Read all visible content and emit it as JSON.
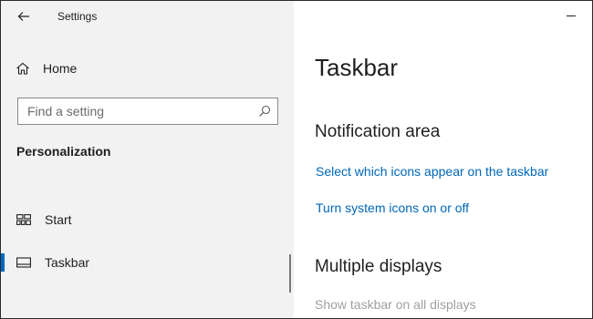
{
  "window": {
    "title": "Settings"
  },
  "sidebar": {
    "home_label": "Home",
    "search": {
      "placeholder": "Find a setting",
      "value": ""
    },
    "section_title": "Personalization",
    "items": [
      {
        "label": "Start",
        "icon": "start-icon",
        "selected": false
      },
      {
        "label": "Taskbar",
        "icon": "taskbar-icon",
        "selected": true
      }
    ]
  },
  "main": {
    "page_title": "Taskbar",
    "notification_area": {
      "heading": "Notification area",
      "links": [
        "Select which icons appear on the taskbar",
        "Turn system icons on or off"
      ]
    },
    "multiple_displays": {
      "heading": "Multiple displays",
      "show_all_label": "Show taskbar on all displays"
    }
  },
  "colors": {
    "accent": "#0067c0",
    "link": "#0067b8",
    "sidebar_bg": "#f2f2f2",
    "disabled_text": "#a0a0a0"
  }
}
